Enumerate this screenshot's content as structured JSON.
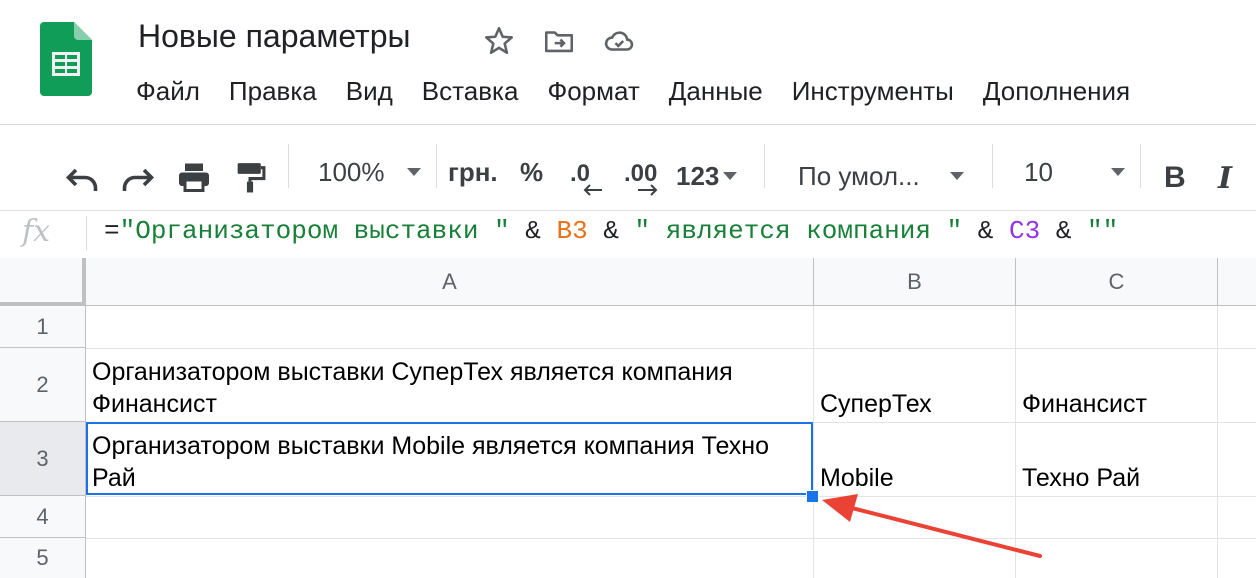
{
  "app": {
    "title": "Новые параметры",
    "icons": [
      "star-icon",
      "move-to-folder-icon",
      "cloud-saved-icon"
    ]
  },
  "menu": [
    "Файл",
    "Правка",
    "Вид",
    "Вставка",
    "Формат",
    "Данные",
    "Инструменты",
    "Дополнения"
  ],
  "toolbar": {
    "zoom": "100%",
    "currency": "грн.",
    "percent": "%",
    "decrease_decimal": ".0",
    "increase_decimal": ".00",
    "more_formats": "123",
    "font": "По умол...",
    "font_size": "10",
    "bold": "B",
    "italic": "I"
  },
  "formula_bar": {
    "fx": "fx",
    "parts": {
      "eq": "=",
      "str1": "\"Организатором выставки \"",
      "amp1": " & ",
      "ref1": "B3",
      "amp2": " & ",
      "str2": "\" является компания \"",
      "amp3": " & ",
      "ref2": "C3",
      "amp4": " & ",
      "str3": "\"\""
    }
  },
  "sheet": {
    "columns": [
      "A",
      "B",
      "C"
    ],
    "rows": [
      "1",
      "2",
      "3",
      "4",
      "5"
    ],
    "cells": {
      "A2": "Организатором выставки СуперТех является компания Финансист",
      "B2": "СуперТех",
      "C2": "Финансист",
      "A3": "Организатором выставки Mobile является компания Техно Рай",
      "B3": "Mobile",
      "C3": "Техно Рай"
    }
  },
  "annotation": {
    "arrow_color": "#ea4335"
  }
}
